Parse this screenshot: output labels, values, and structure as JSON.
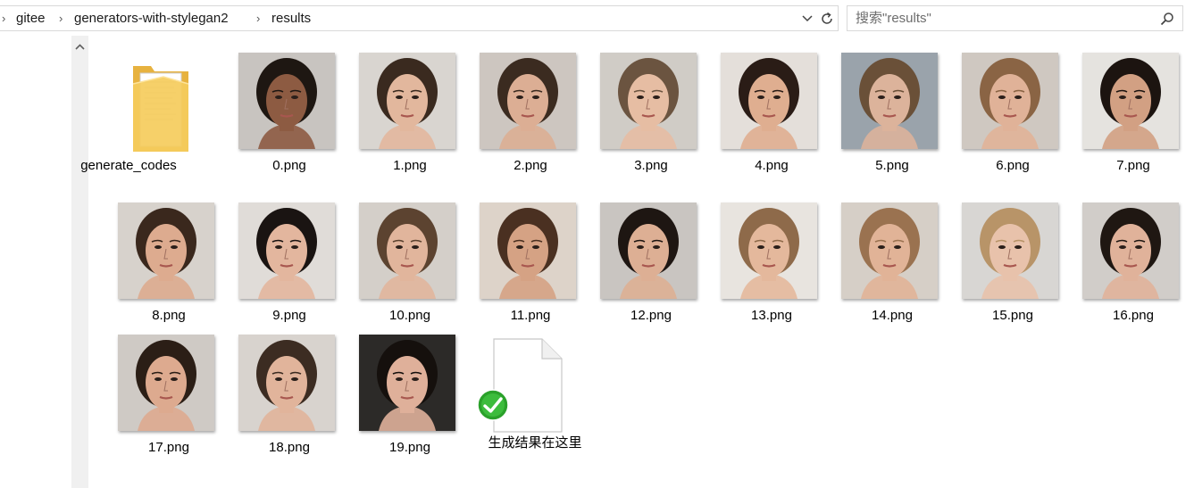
{
  "address_bar": {
    "crumbs": [
      "gitee",
      "generators-with-stylegan2",
      "results"
    ]
  },
  "search": {
    "placeholder": "搜索\"results\""
  },
  "folder": {
    "name": "generate_codes"
  },
  "images": [
    {
      "label": "0.png",
      "bg": "#c8c4c0",
      "skin": "#8d5b42",
      "hair": "#1e1712"
    },
    {
      "label": "1.png",
      "bg": "#d9d5d0",
      "skin": "#e2b79d",
      "hair": "#3a2a1f"
    },
    {
      "label": "2.png",
      "bg": "#cdc6c0",
      "skin": "#dcae94",
      "hair": "#3b2b20"
    },
    {
      "label": "3.png",
      "bg": "#d0ccc6",
      "skin": "#e6bda3",
      "hair": "#6b5440"
    },
    {
      "label": "4.png",
      "bg": "#e4dfda",
      "skin": "#dfae90",
      "hair": "#2a1c16"
    },
    {
      "label": "5.png",
      "bg": "#9aa3ab",
      "skin": "#dcb39b",
      "hair": "#6a5038"
    },
    {
      "label": "6.png",
      "bg": "#cfc8c1",
      "skin": "#e0b298",
      "hair": "#8a6444"
    },
    {
      "label": "7.png",
      "bg": "#e5e3df",
      "skin": "#d2a083",
      "hair": "#1c1410"
    },
    {
      "label": "8.png",
      "bg": "#d7d2cc",
      "skin": "#ddab8f",
      "hair": "#3a281d"
    },
    {
      "label": "9.png",
      "bg": "#e0dcd8",
      "skin": "#e3b69e",
      "hair": "#1a1412"
    },
    {
      "label": "10.png",
      "bg": "#d4cfc9",
      "skin": "#e1b59c",
      "hair": "#5c4330"
    },
    {
      "label": "11.png",
      "bg": "#ddd3c9",
      "skin": "#d5a284",
      "hair": "#4a3021"
    },
    {
      "label": "12.png",
      "bg": "#c9c5c1",
      "skin": "#ddaf94",
      "hair": "#1e1612"
    },
    {
      "label": "13.png",
      "bg": "#e8e4df",
      "skin": "#e4b89c",
      "hair": "#8e6a4a"
    },
    {
      "label": "14.png",
      "bg": "#d6cfc7",
      "skin": "#e1b397",
      "hair": "#9a7250"
    },
    {
      "label": "15.png",
      "bg": "#d8d6d3",
      "skin": "#e8c2ab",
      "hair": "#b89468"
    },
    {
      "label": "16.png",
      "bg": "#d1cdc9",
      "skin": "#e0b29a",
      "hair": "#1f1712"
    },
    {
      "label": "17.png",
      "bg": "#cfcac5",
      "skin": "#ddaa8f",
      "hair": "#2b1e16"
    },
    {
      "label": "18.png",
      "bg": "#d8d3ce",
      "skin": "#e1b49b",
      "hair": "#3c2c22"
    },
    {
      "label": "19.png",
      "bg": "#2c2a28",
      "skin": "#dfb09a",
      "hair": "#15100d"
    }
  ],
  "note_file": {
    "label": "生成结果在这里"
  },
  "colors": {
    "folder": "#f5cc5c",
    "check": "#2aa12a"
  }
}
